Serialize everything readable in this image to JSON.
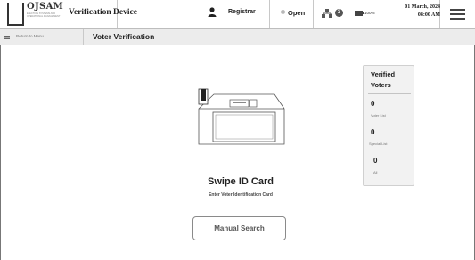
{
  "header": {
    "logo_text": "OJSAM",
    "logo_subtext": "ELECTION SYSTEMS AND OPERATIONAL MANAGEMENT",
    "device_title": "Verification Device",
    "role_label": "Registrar",
    "poll_status": "Open",
    "pending_count": "3",
    "battery_label": "100%",
    "date_label": "01 March, 2024",
    "time_label": "08:00 AM"
  },
  "subbar": {
    "back_label": "Return to Menu",
    "page_title": "Voter Verification"
  },
  "main": {
    "swipe_title": "Swipe ID Card",
    "swipe_subtitle": "Enter Voter Identification Card",
    "manual_search_label": "Manual Search"
  },
  "verified_panel": {
    "title": "Verified Voters",
    "items": [
      {
        "count": "0",
        "label": "Voter List"
      },
      {
        "count": "0",
        "label": "Special List"
      },
      {
        "count": "0",
        "label": "All"
      }
    ]
  },
  "icons": {
    "user": "user-icon",
    "network": "network-icon",
    "battery": "battery-icon",
    "menu": "hamburger-menu-icon",
    "back": "back-arrow-icon",
    "card_reader": "card-reader-illustration"
  },
  "colors": {
    "panel_bg": "#f2f2f2",
    "subbar_bg": "#ececec",
    "status_dot": "#b8b8b8"
  }
}
